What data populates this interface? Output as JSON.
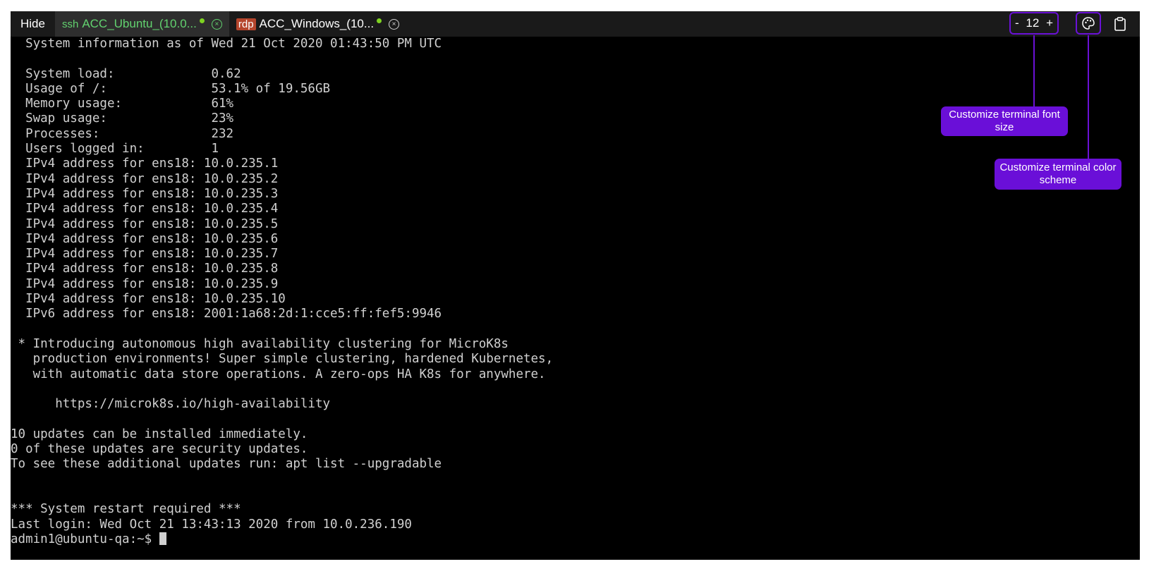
{
  "tabbar": {
    "hide_label": "Hide",
    "tabs": [
      {
        "protocol": "ssh",
        "title": "ACC_Ubuntu_(10.0...",
        "close_glyph": "×"
      },
      {
        "protocol": "rdp",
        "title": "ACC_Windows_(10...",
        "close_glyph": "×"
      }
    ]
  },
  "font_control": {
    "minus": "-",
    "value": "12",
    "plus": "+"
  },
  "icons": {
    "palette": "palette-icon",
    "clipboard": "clipboard-icon"
  },
  "colors": {
    "accent": "#6a11d6",
    "ssh_green": "#62d26f",
    "rdp_badge": "#b5452c",
    "status_dot": "#7ed321"
  },
  "terminal": {
    "lines": [
      "  System information as of Wed 21 Oct 2020 01:43:50 PM UTC",
      "",
      "  System load:             0.62",
      "  Usage of /:              53.1% of 19.56GB",
      "  Memory usage:            61%",
      "  Swap usage:              23%",
      "  Processes:               232",
      "  Users logged in:         1",
      "  IPv4 address for ens18: 10.0.235.1",
      "  IPv4 address for ens18: 10.0.235.2",
      "  IPv4 address for ens18: 10.0.235.3",
      "  IPv4 address for ens18: 10.0.235.4",
      "  IPv4 address for ens18: 10.0.235.5",
      "  IPv4 address for ens18: 10.0.235.6",
      "  IPv4 address for ens18: 10.0.235.7",
      "  IPv4 address for ens18: 10.0.235.8",
      "  IPv4 address for ens18: 10.0.235.9",
      "  IPv4 address for ens18: 10.0.235.10",
      "  IPv6 address for ens18: 2001:1a68:2d:1:cce5:ff:fef5:9946",
      "",
      " * Introducing autonomous high availability clustering for MicroK8s",
      "   production environments! Super simple clustering, hardened Kubernetes,",
      "   with automatic data store operations. A zero-ops HA K8s for anywhere.",
      "",
      "      https://microk8s.io/high-availability",
      "",
      "10 updates can be installed immediately.",
      "0 of these updates are security updates.",
      "To see these additional updates run: apt list --upgradable",
      "",
      "",
      "*** System restart required ***",
      "Last login: Wed Oct 21 13:43:13 2020 from 10.0.236.190"
    ],
    "prompt": "admin1@ubuntu-qa:~$ "
  },
  "callouts": {
    "font_size": "Customize terminal font size",
    "color_scheme": "Customize terminal color scheme"
  }
}
